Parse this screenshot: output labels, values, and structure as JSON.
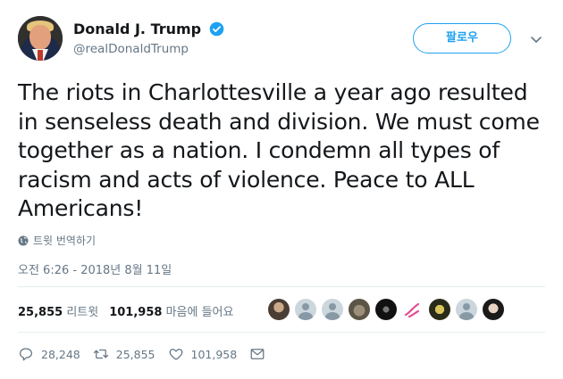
{
  "user": {
    "display_name": "Donald J. Trump",
    "handle": "@realDonaldTrump",
    "verified": true,
    "verified_color": "#1da1f2"
  },
  "follow_button": {
    "label": "팔로우"
  },
  "tweet": {
    "text": "The riots in Charlottesville a year ago resulted in senseless death and division. We must come together as a nation. I condemn all types of racism and acts of violence. Peace to ALL Americans!",
    "translate_label": "트윗 번역하기",
    "timestamp": "오전 6:26 - 2018년 8월 11일"
  },
  "stats": {
    "retweets_count": "25,855",
    "retweets_label": "리트윗",
    "likes_count": "101,958",
    "likes_label": "마음에 들어요"
  },
  "likers": [
    {
      "icon": "liker-avatar-photo"
    },
    {
      "icon": "default-avatar"
    },
    {
      "icon": "default-avatar"
    },
    {
      "icon": "liker-avatar-wolf"
    },
    {
      "icon": "liker-avatar-dark"
    },
    {
      "icon": "liker-avatar-pink"
    },
    {
      "icon": "liker-avatar-emblem"
    },
    {
      "icon": "default-avatar"
    },
    {
      "icon": "liker-avatar-woman"
    }
  ],
  "actions": {
    "reply_count": "28,248",
    "retweet_count": "25,855",
    "like_count": "101,958"
  },
  "colors": {
    "accent": "#1da1f2",
    "text_primary": "#14171a",
    "text_secondary": "#657786",
    "divider": "#e6ecf0"
  }
}
